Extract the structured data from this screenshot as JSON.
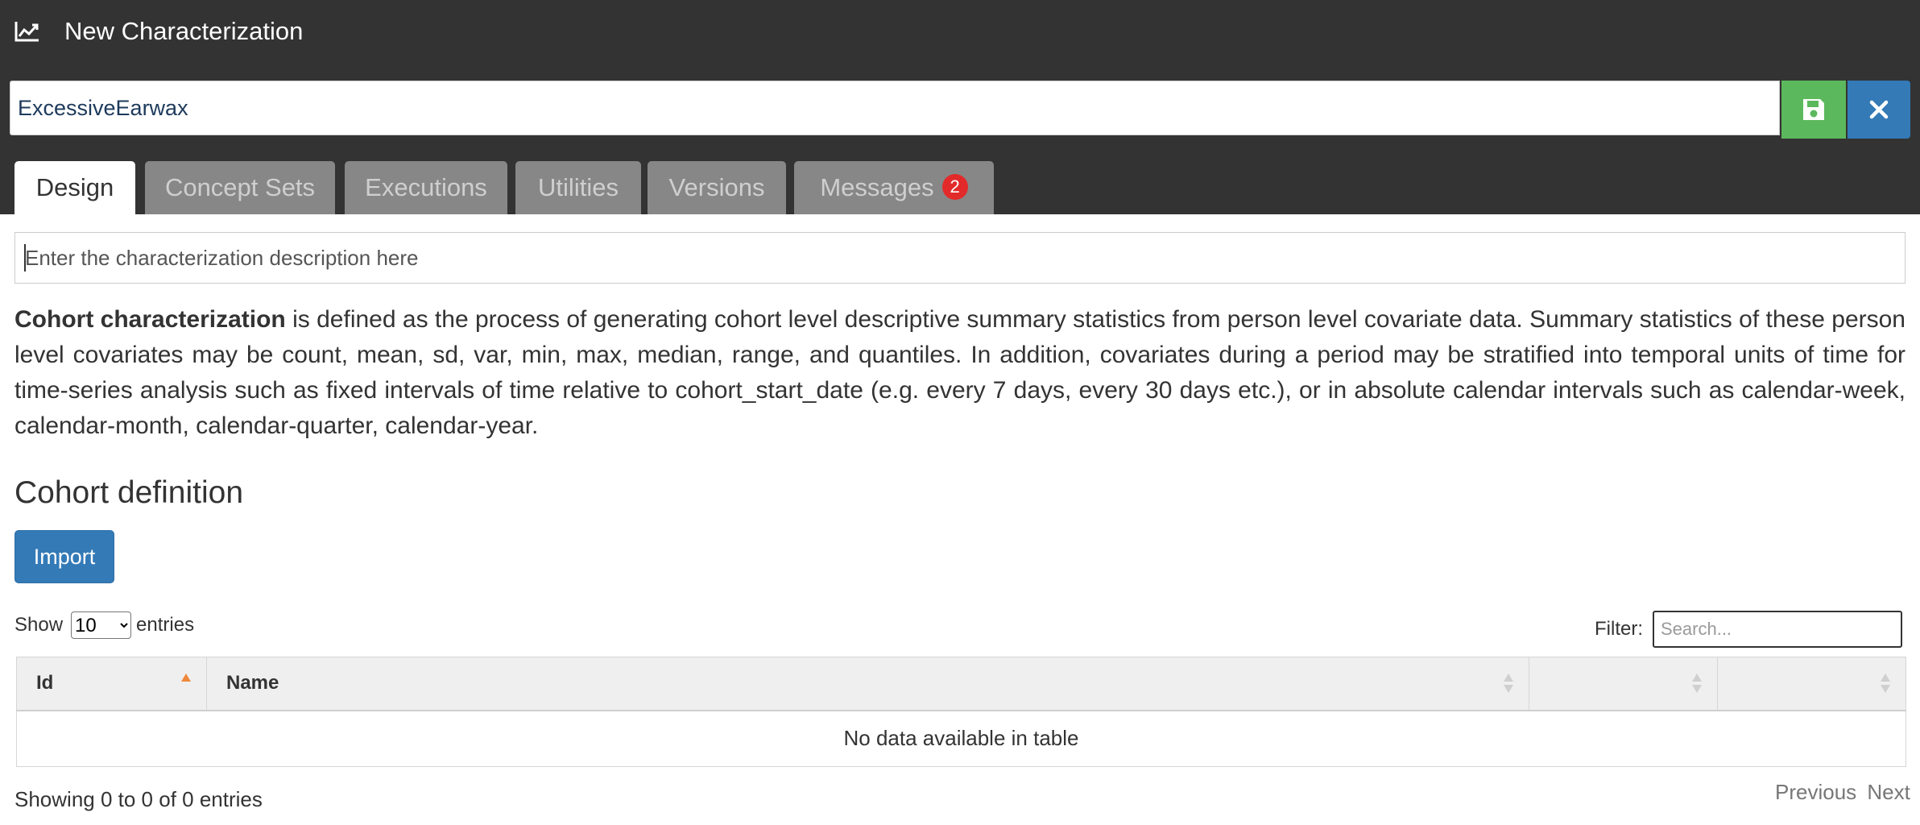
{
  "header": {
    "title": "New Characterization",
    "icon": "line-chart-icon"
  },
  "name_field": {
    "value": "ExcessiveEarwax"
  },
  "colors": {
    "save": "#5cb85c",
    "close": "#337ab7",
    "badge": "#e22a2a",
    "sort_active": "#f0883a",
    "dark": "#333333"
  },
  "tabs": [
    {
      "label": "Design",
      "active": true
    },
    {
      "label": "Concept Sets",
      "active": false
    },
    {
      "label": "Executions",
      "active": false
    },
    {
      "label": "Utilities",
      "active": false
    },
    {
      "label": "Versions",
      "active": false
    },
    {
      "label": "Messages",
      "active": false,
      "badge": "2"
    }
  ],
  "description": {
    "placeholder": "Enter the characterization description here"
  },
  "intro": {
    "bold": "Cohort characterization",
    "text": " is defined as the process of generating cohort level descriptive summary statistics from person level covariate data. Summary statistics of these person level covariates may be count, mean, sd, var, min, max, median, range, and quantiles. In addition, covariates during a period may be stratified into temporal units of time for time-series analysis such as fixed intervals of time relative to cohort_start_date (e.g. every 7 days, every 30 days etc.), or in absolute calendar intervals such as calendar-week, calendar-month, calendar-quarter, calendar-year."
  },
  "cohort_section": {
    "title": "Cohort definition",
    "import_label": "Import",
    "show_label": "Show",
    "entries_label": "entries",
    "page_size": "10",
    "filter_label": "Filter:",
    "filter_placeholder": "Search...",
    "columns": [
      "Id",
      "Name",
      "",
      ""
    ],
    "empty_message": "No data available in table",
    "info": "Showing 0 to 0 of 0 entries",
    "previous": "Previous",
    "next": "Next"
  }
}
